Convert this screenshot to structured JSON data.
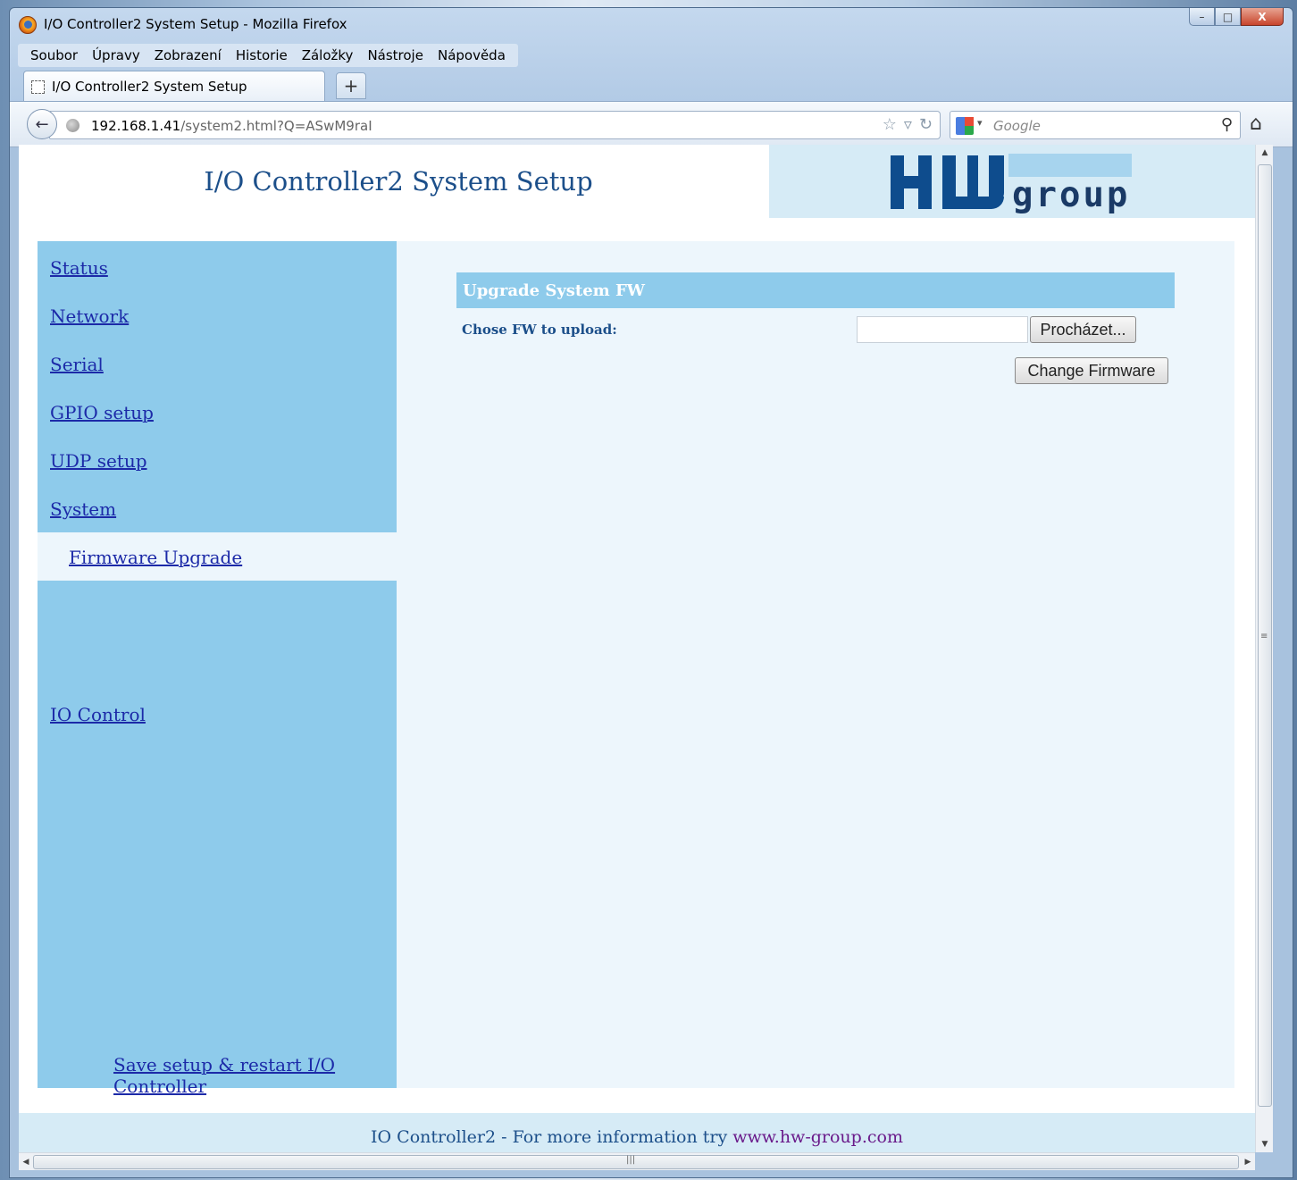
{
  "window": {
    "title": "I/O Controller2 System Setup - Mozilla Firefox",
    "minimize": "–",
    "maximize": "□",
    "close": "X"
  },
  "menu": [
    "Soubor",
    "Úpravy",
    "Zobrazení",
    "Historie",
    "Záložky",
    "Nástroje",
    "Nápověda"
  ],
  "tab": {
    "label": "I/O Controller2 System Setup",
    "new_tab": "+"
  },
  "navbar": {
    "url_host": "192.168.1.41",
    "url_path": "/system2.html?Q=ASwM9raI",
    "search_placeholder": "Google"
  },
  "page": {
    "title": "I/O Controller2 System Setup",
    "logo_text": "group",
    "nav": {
      "status": "Status",
      "network": "Network",
      "serial": "Serial",
      "gpio": "GPIO setup",
      "udp": "UDP setup",
      "system": "System",
      "firmware": "Firmware Upgrade",
      "io_control": "IO Control",
      "save": "Save setup & restart I/O Controller"
    },
    "panel": {
      "title": "Upgrade System FW",
      "label": "Chose FW to upload:",
      "browse": "Procházet...",
      "change": "Change Firmware"
    },
    "footer": {
      "text": "IO Controller2 - For more information try ",
      "link": "www.hw-group.com"
    }
  }
}
